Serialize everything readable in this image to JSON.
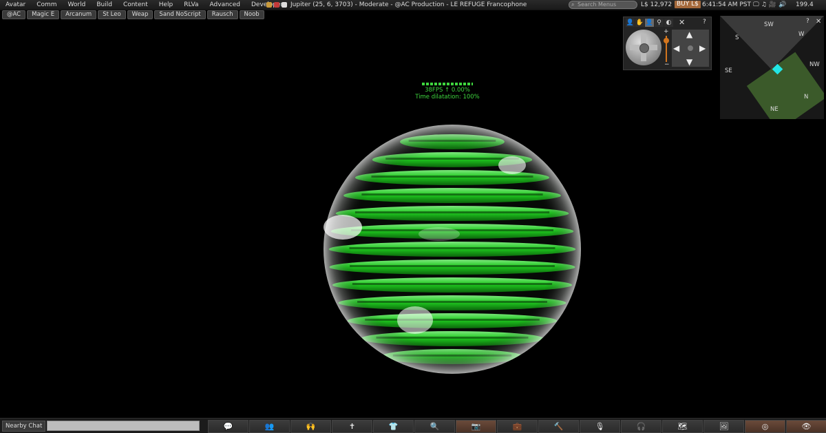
{
  "menubar": {
    "items": [
      "Avatar",
      "Comm",
      "World",
      "Build",
      "Content",
      "Help",
      "RLVa",
      "Advanced",
      "Developer"
    ],
    "location": "Jupiter (25, 6, 3703) - Moderate - @AC Production - LE REFUGE Francophone",
    "search_placeholder": "Search Menus",
    "balance": "L$ 12,972",
    "buy_label": "BUY L$",
    "time": "6:41:54 AM PST",
    "bandwidth": "199.4"
  },
  "favorites": [
    "@AC",
    "Magic E",
    "Arcanum",
    "St Leo",
    "Weap",
    "Sand NoScript",
    "Rausch",
    "Noob"
  ],
  "stats": {
    "fps_line": "38FPS ↑ 0.00%",
    "time_dilation": "Time dilatation: 100%"
  },
  "minimap": {
    "directions": {
      "sw": "SW",
      "w": "W",
      "s": "S",
      "nw": "NW",
      "se": "SE",
      "n": "N",
      "ne": "NE"
    },
    "help": "?"
  },
  "camera": {
    "help": "?",
    "zoom_plus": "+",
    "zoom_minus": "−"
  },
  "bottombar": {
    "nearby_chat": "Nearby Chat",
    "tools": [
      {
        "name": "chat-icon",
        "glyph": "💬"
      },
      {
        "name": "people-icon",
        "glyph": "👥"
      },
      {
        "name": "gestures-icon",
        "glyph": "🙌"
      },
      {
        "name": "pose-icon",
        "glyph": "✝"
      },
      {
        "name": "appearance-icon",
        "glyph": "👕"
      },
      {
        "name": "search-icon",
        "glyph": "🔍"
      },
      {
        "name": "snapshot-icon",
        "glyph": "📷"
      },
      {
        "name": "inventory-icon",
        "glyph": "💼"
      },
      {
        "name": "build-icon",
        "glyph": "🔨"
      },
      {
        "name": "voice-icon",
        "glyph": "🎙"
      },
      {
        "name": "headset-icon",
        "glyph": "🎧"
      },
      {
        "name": "map-icon",
        "glyph": "🗺"
      },
      {
        "name": "minimap-icon",
        "glyph": "🖼"
      },
      {
        "name": "radar-icon",
        "glyph": "◎"
      },
      {
        "name": "view-icon",
        "glyph": "👁"
      }
    ]
  },
  "colors": {
    "stats_green": "#3ed63e",
    "sphere_green": "#22e022",
    "buy_button": "#a56a3c",
    "zoom_orange": "#d4761e",
    "minimap_avatar": "#22e6e6"
  }
}
